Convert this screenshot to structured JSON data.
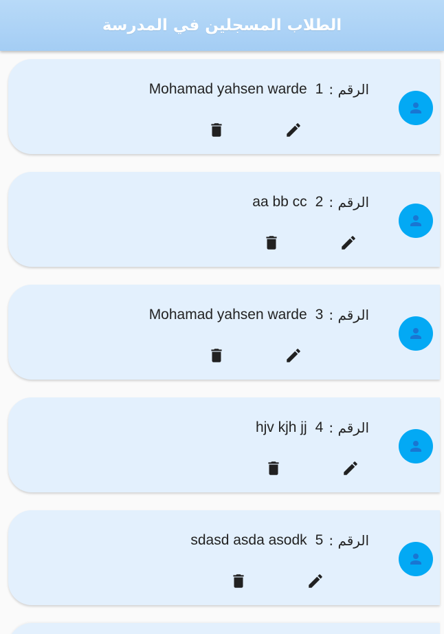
{
  "appbar": {
    "title": "الطلاب المسجلين في المدرسة"
  },
  "label_prefix": "الرقم :",
  "students": [
    {
      "number": "1",
      "name": "Mohamad yahsen warde"
    },
    {
      "number": "2",
      "name": "aa bb cc"
    },
    {
      "number": "3",
      "name": "Mohamad yahsen warde"
    },
    {
      "number": "4",
      "name": "hjv kjh jj"
    },
    {
      "number": "5",
      "name": "sdasd asda asodk"
    }
  ],
  "icons": {
    "avatar": "person-icon",
    "delete": "delete-icon",
    "edit": "edit-icon"
  },
  "colors": {
    "appbar": "#a4cdf4",
    "card": "#e3f0fd",
    "avatar": "#03a9f4",
    "avatar_icon": "#1976d2",
    "icons": "#212121"
  }
}
